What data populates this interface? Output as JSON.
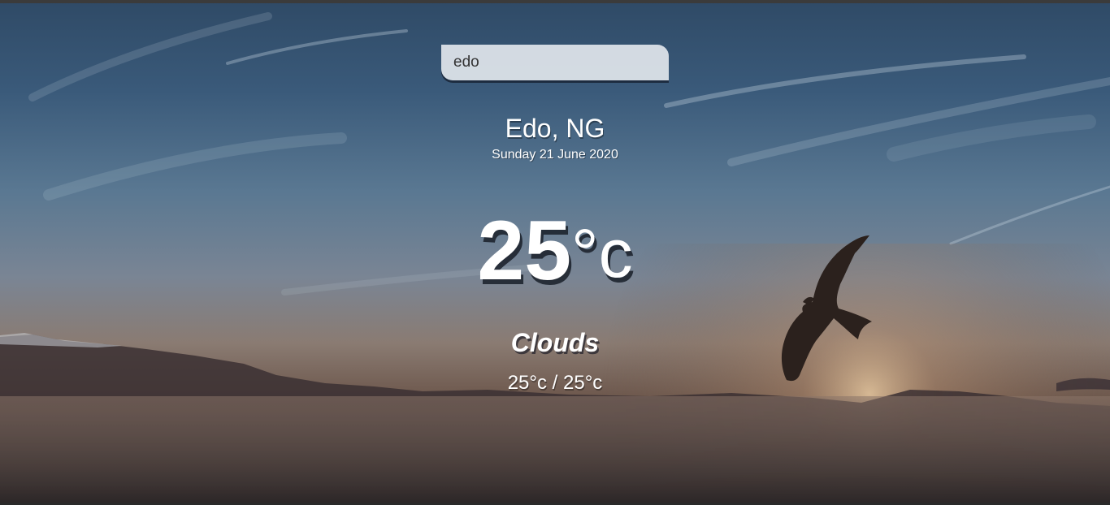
{
  "search": {
    "value": "edo"
  },
  "location": {
    "city": "Edo, NG",
    "date": "Sunday 21 June 2020"
  },
  "weather": {
    "temperature": "25",
    "unit": "°c",
    "condition": "Clouds",
    "hi_low": "25°c / 25°c"
  },
  "icons": {
    "bird": "bird-silhouette-icon"
  }
}
